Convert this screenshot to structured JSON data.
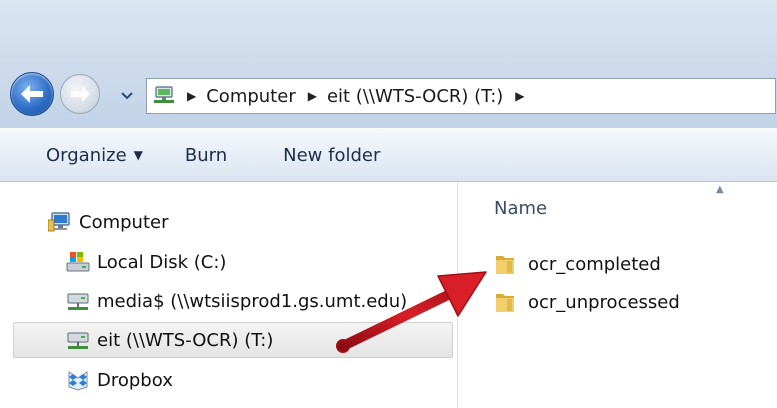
{
  "address_bar": {
    "crumbs": [
      "Computer",
      "eit (\\\\WTS-OCR) (T:)"
    ]
  },
  "toolbar": {
    "organize_label": "Organize",
    "burn_label": "Burn",
    "new_folder_label": "New folder"
  },
  "nav_pane": {
    "items": [
      {
        "label": "Computer",
        "icon": "computer-icon"
      },
      {
        "label": "Local Disk (C:)",
        "icon": "local-disk-icon"
      },
      {
        "label": "media$ (\\\\wtsiisprod1.gs.umt.edu)",
        "icon": "network-drive-icon"
      },
      {
        "label": "eit (\\\\WTS-OCR) (T:)",
        "icon": "network-drive-icon",
        "selected": true
      },
      {
        "label": "Dropbox",
        "icon": "dropbox-icon"
      }
    ]
  },
  "content": {
    "column_header": "Name",
    "files": [
      {
        "name": "ocr_completed",
        "icon": "folder-icon"
      },
      {
        "name": "ocr_unprocessed",
        "icon": "folder-icon"
      }
    ]
  },
  "colors": {
    "annotation_arrow": "#c8141e",
    "selection_bg": "#e6e6e6",
    "folder": "#e8c25a"
  }
}
